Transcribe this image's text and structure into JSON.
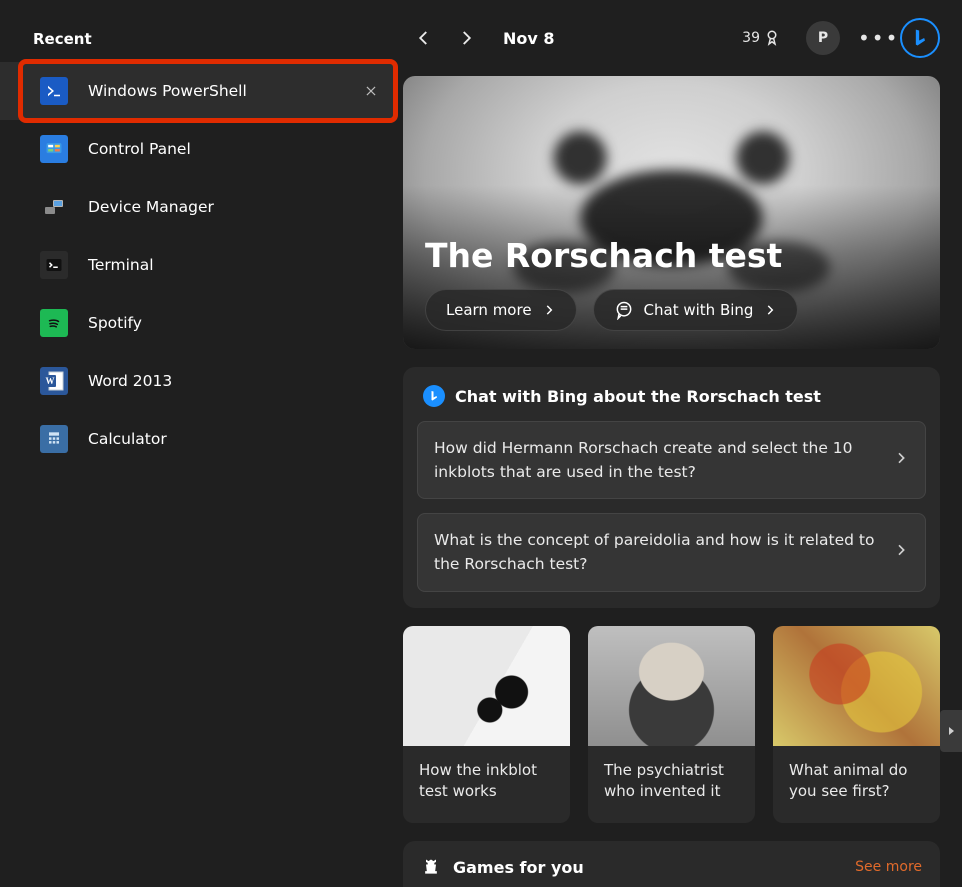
{
  "sidebar": {
    "title": "Recent",
    "items": [
      {
        "label": "Windows PowerShell",
        "icon": "powershell-icon",
        "highlight": true,
        "closable": true
      },
      {
        "label": "Control Panel",
        "icon": "control-panel-icon"
      },
      {
        "label": "Device Manager",
        "icon": "device-manager-icon"
      },
      {
        "label": "Terminal",
        "icon": "terminal-icon"
      },
      {
        "label": "Spotify",
        "icon": "spotify-icon"
      },
      {
        "label": "Word 2013",
        "icon": "word-icon"
      },
      {
        "label": "Calculator",
        "icon": "calculator-icon"
      }
    ]
  },
  "topbar": {
    "date": "Nov 8",
    "rewards_points": "39",
    "user_initial": "P"
  },
  "hero": {
    "title": "The Rorschach test",
    "learn_more_label": "Learn more",
    "chat_label": "Chat with Bing"
  },
  "chat_panel": {
    "title": "Chat with Bing about the Rorschach test",
    "questions": [
      "How did Hermann Rorschach create and select the 10 inkblots that are used in the test?",
      "What is the concept of pareidolia and how is it related to the Rorschach test?"
    ]
  },
  "cards": [
    {
      "caption": "How the inkblot test works"
    },
    {
      "caption": "The psychiatrist who invented it"
    },
    {
      "caption": "What animal do you see first?"
    }
  ],
  "games": {
    "title": "Games for you",
    "see_more": "See more"
  },
  "colors": {
    "highlight_border": "#e02b00",
    "bing_blue": "#1a8fff",
    "see_more": "#e06a2b"
  }
}
